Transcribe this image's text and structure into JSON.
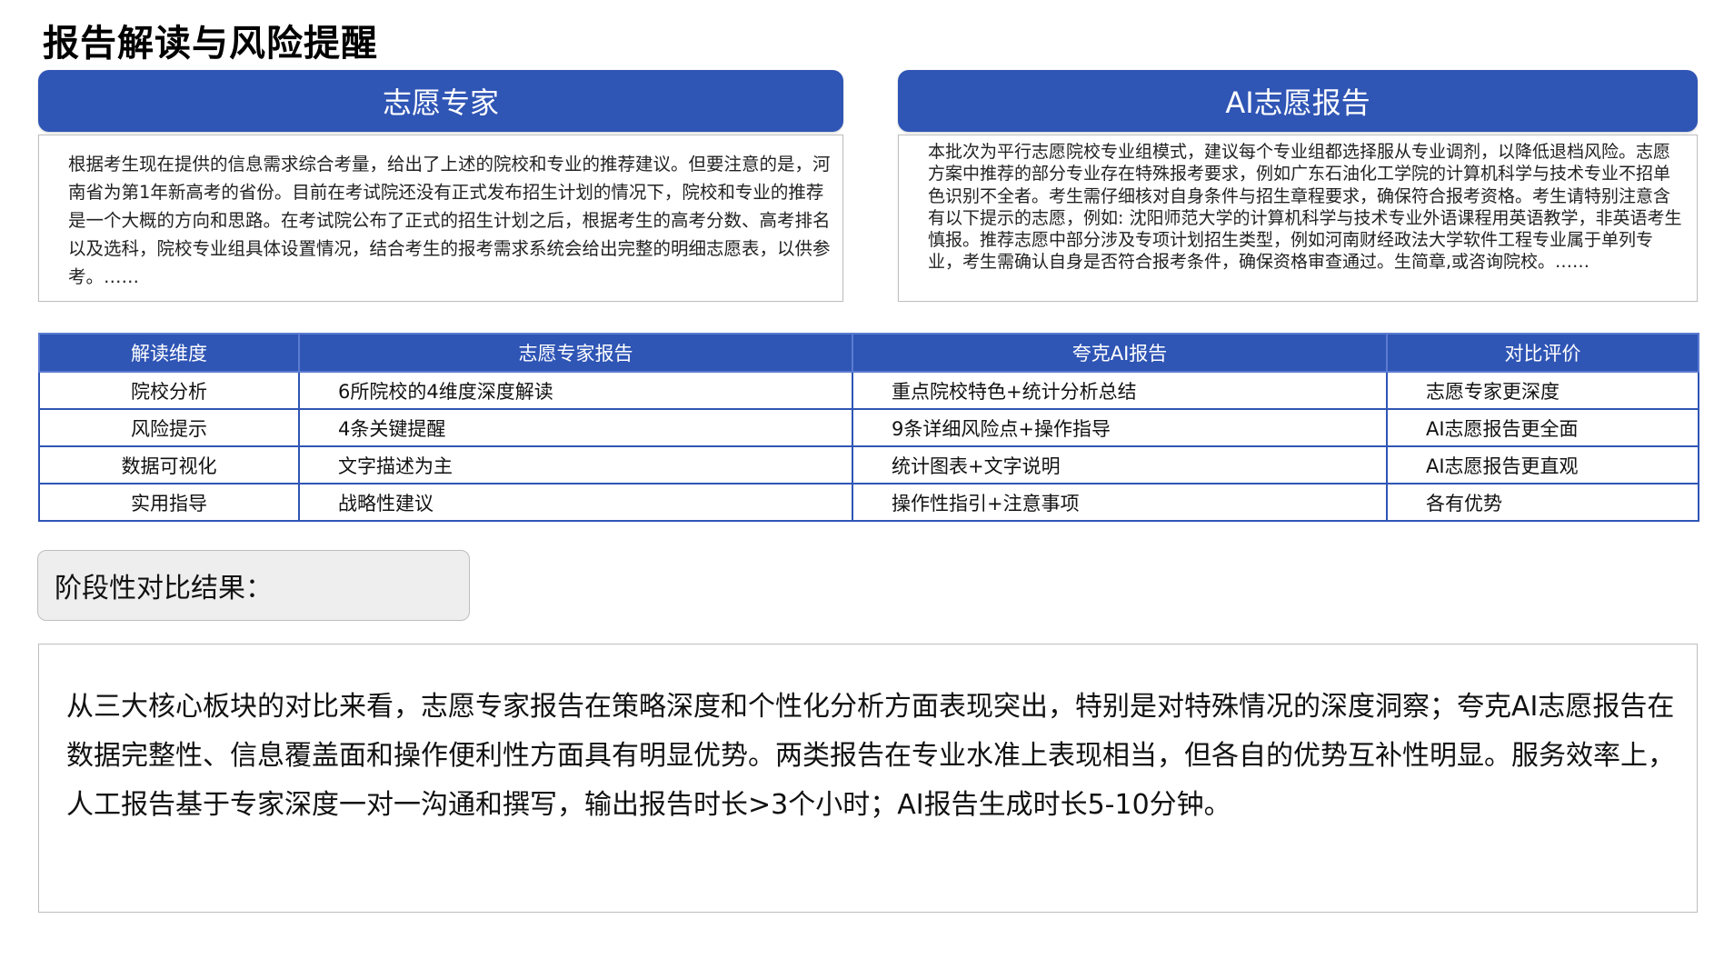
{
  "page": {
    "title": "报告解读与风险提醒"
  },
  "panels": {
    "left": {
      "header": "志愿专家",
      "text": "根据考生现在提供的信息需求综合考量，给出了上述的院校和专业的推荐建议。但要注意的是，河南省为第1年新高考的省份。目前在考试院还没有正式发布招生计划的情况下，院校和专业的推荐是一个大概的方向和思路。在考试院公布了正式的招生计划之后，根据考生的高考分数、高考排名以及选科，院校专业组具体设置情况，结合考生的报考需求系统会给出完整的明细志愿表，以供参考。……"
    },
    "right": {
      "header": "AI志愿报告",
      "text": "本批次为平行志愿院校专业组模式，建议每个专业组都选择服从专业调剂，以降低退档风险。志愿方案中推荐的部分专业存在特殊报考要求，例如广东石油化工学院的计算机科学与技术专业不招单色识别不全者。考生需仔细核对自身条件与招生章程要求，确保符合报考资格。考生请特别注意含有以下提示的志愿，例如: 沈阳师范大学的计算机科学与技术专业外语课程用英语教学，非英语考生慎报。推荐志愿中部分涉及专项计划招生类型，例如河南财经政法大学软件工程专业属于单列专业，考生需确认自身是否符合报考条件，确保资格审查通过。生简章,或咨询院校。……"
    }
  },
  "table": {
    "headers": [
      "解读维度",
      "志愿专家报告",
      "夸克AI报告",
      "对比评价"
    ],
    "rows": [
      [
        "院校分析",
        "6所院校的4维度深度解读",
        "重点院校特色+统计分析总结",
        "志愿专家更深度"
      ],
      [
        "风险提示",
        "4条关键提醒",
        "9条详细风险点+操作指导",
        "AI志愿报告更全面"
      ],
      [
        "数据可视化",
        "文字描述为主",
        "统计图表+文字说明",
        "AI志愿报告更直观"
      ],
      [
        "实用指导",
        "战略性建议",
        "操作性指引+注意事项",
        "各有优势"
      ]
    ]
  },
  "result": {
    "label": "阶段性对比结果：",
    "summary": "从三大核心板块的对比来看，志愿专家报告在策略深度和个性化分析方面表现突出，特别是对特殊情况的深度洞察；夸克AI志愿报告在数据完整性、信息覆盖面和操作便利性方面具有明显优势。两类报告在专业水准上表现相当，但各自的优势互补性明显。服务效率上，人工报告基于专家深度一对一沟通和撰写，输出报告时长>3个小时；AI报告生成时长5-10分钟。"
  },
  "colors": {
    "accent_blue": "#2f55b5",
    "box_gray": "#eeeeee"
  }
}
